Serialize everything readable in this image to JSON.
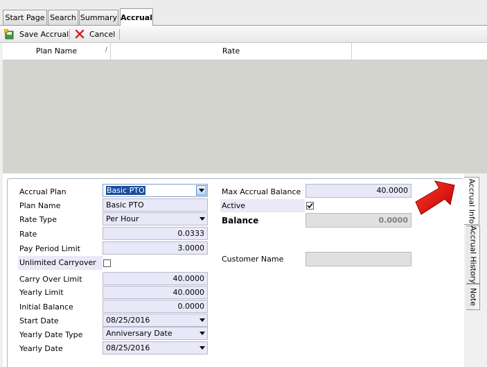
{
  "tabs": [
    {
      "label": "Start Page"
    },
    {
      "label": "Search"
    },
    {
      "label": "Summary"
    },
    {
      "label": "Accrual"
    }
  ],
  "toolbar": {
    "save_label": "Save Accrual",
    "cancel_label": "Cancel"
  },
  "grid": {
    "columns": [
      "Plan Name",
      "Rate"
    ]
  },
  "form": {
    "accrual_plan": {
      "label": "Accrual Plan",
      "value": "Basic PTO"
    },
    "plan_name": {
      "label": "Plan Name",
      "value": "Basic PTO"
    },
    "rate_type": {
      "label": "Rate Type",
      "value": "Per Hour"
    },
    "rate": {
      "label": "Rate",
      "value": "0.0333"
    },
    "pay_period_limit": {
      "label": "Pay Period Limit",
      "value": "3.0000"
    },
    "unlimited_carryover": {
      "label": "Unlimited Carryover",
      "checked": false
    },
    "carry_over_limit": {
      "label": "Carry Over Limit",
      "value": "40.0000"
    },
    "yearly_limit": {
      "label": "Yearly Limit",
      "value": "40.0000"
    },
    "initial_balance": {
      "label": "Initial Balance",
      "value": "0.0000"
    },
    "start_date": {
      "label": "Start Date",
      "value": "08/25/2016"
    },
    "yearly_date_type": {
      "label": "Yearly Date Type",
      "value": "Anniversary Date"
    },
    "yearly_date": {
      "label": "Yearly Date",
      "value": "08/25/2016"
    },
    "max_accrual_balance": {
      "label": "Max Accrual Balance",
      "value": "40.0000"
    },
    "active": {
      "label": "Active",
      "checked": true
    },
    "balance": {
      "label": "Balance",
      "value": "0.0000"
    },
    "customer_name": {
      "label": "Customer Name",
      "value": ""
    }
  },
  "side_tabs": [
    {
      "label": "Accrual Info"
    },
    {
      "label": "Accrual History"
    },
    {
      "label": "Note"
    }
  ],
  "colors": {
    "arrow": "#e8120c",
    "field_bg": "#e8e8f8",
    "selection": "#1c4e9c"
  }
}
